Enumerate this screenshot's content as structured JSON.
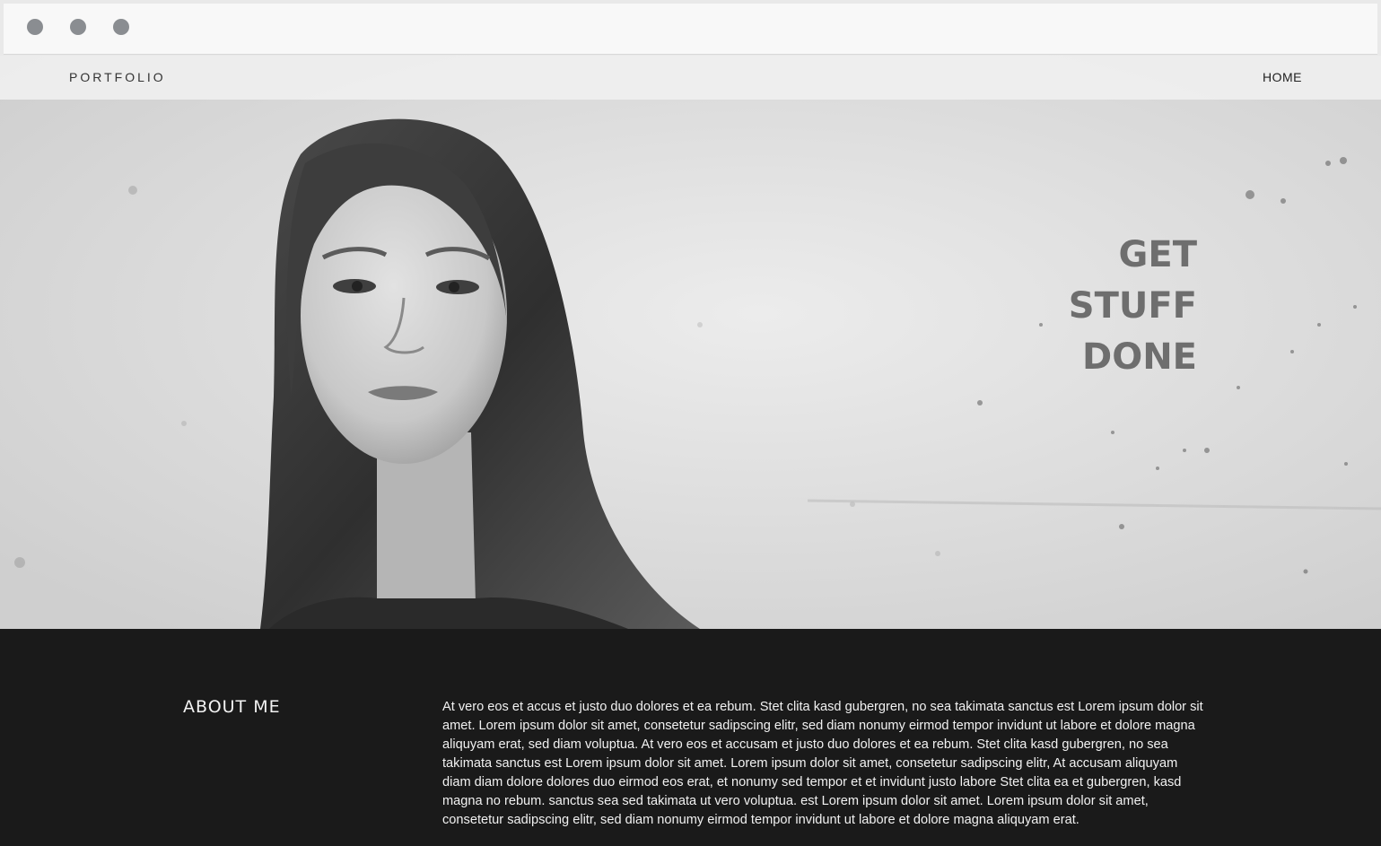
{
  "window": {
    "controls": [
      "close",
      "minimize",
      "maximize"
    ]
  },
  "nav": {
    "brand": "PORTFOLIO",
    "home": "HOME"
  },
  "hero": {
    "headline_lines": [
      "GET",
      "STUFF",
      "DONE"
    ]
  },
  "about": {
    "title": "ABOUT ME",
    "body": "At vero eos et accus et justo duo dolores et ea rebum. Stet clita kasd gubergren, no sea takimata sanctus est Lorem ipsum dolor sit amet. Lorem ipsum dolor sit amet, consetetur sadipscing elitr, sed diam nonumy eirmod tempor invidunt ut labore et dolore magna aliquyam erat, sed diam voluptua. At vero eos et accusam et justo duo dolores et ea rebum. Stet clita kasd gubergren, no sea takimata sanctus est Lorem ipsum dolor sit amet. Lorem ipsum dolor sit amet, consetetur sadipscing elitr, At accusam aliquyam diam diam dolore dolores duo eirmod eos erat, et nonumy sed tempor et et invidunt justo labore Stet clita ea et gubergren, kasd magna no rebum. sanctus sea sed takimata ut vero voluptua. est Lorem ipsum dolor sit amet. Lorem ipsum dolor sit amet, consetetur sadipscing elitr, sed diam nonumy eirmod tempor invidunt ut labore et dolore magna aliquyam erat."
  },
  "colors": {
    "dark_background": "#1a1a1a",
    "headline": "#6e6e6e",
    "window_dot": "#8a8d91"
  }
}
